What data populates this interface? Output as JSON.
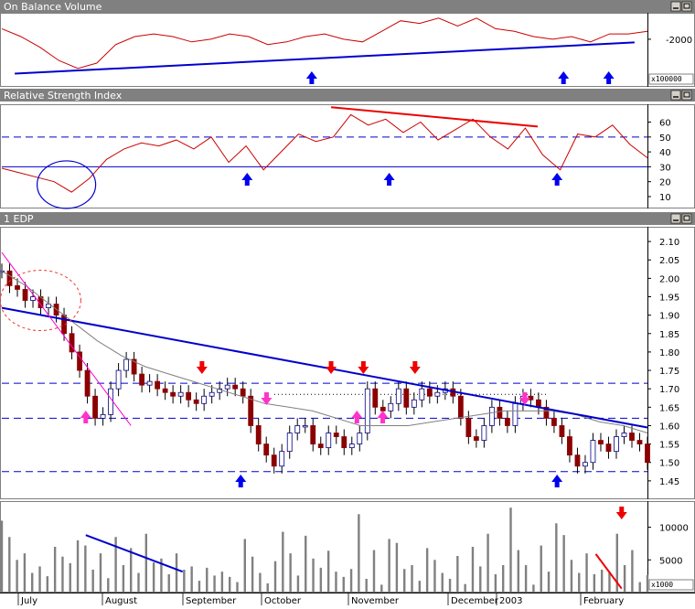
{
  "theme": {
    "titlebar": "#808080",
    "price_line": "#cc0000",
    "trend": "#0000cc",
    "ma": "#808080",
    "volume": "#808080",
    "arrow_blue": "#0000ee",
    "arrow_red": "#ee0000",
    "arrow_magenta": "#ff33cc",
    "divergence": "#ee0000"
  },
  "window_controls": [
    "minimize-icon",
    "maximize-icon"
  ],
  "months": [
    "July",
    "August",
    "September",
    "October",
    "November",
    "December",
    "2003",
    "February"
  ],
  "chart_data": [
    {
      "id": "obv",
      "type": "line",
      "title": "On Balance Volume",
      "scale_label": "x100000",
      "y_ticks": [
        -2000
      ],
      "ylim": [
        -2900,
        -1500
      ],
      "series": [
        {
          "values": [
            -1800,
            -1950,
            -2150,
            -2400,
            -2550,
            -2450,
            -2100,
            -1950,
            -1900,
            -1950,
            -2050,
            -2000,
            -1900,
            -1950,
            -2100,
            -2050,
            -1950,
            -1900,
            -2000,
            -2050,
            -1850,
            -1650,
            -1700,
            -1600,
            -1750,
            -1600,
            -1800,
            -1850,
            -1950,
            -2000,
            -1950,
            -2050,
            -1900,
            -1900,
            -1850
          ]
        }
      ],
      "trendlines": [
        {
          "from": [
            0.02,
            -2650
          ],
          "to": [
            0.98,
            -2060
          ]
        }
      ],
      "annotations": {
        "arrows_up": [
          0.48,
          0.87,
          0.94
        ]
      }
    },
    {
      "id": "rsi",
      "type": "line",
      "title": "Relative Strength Index",
      "y_ticks": [
        10,
        20,
        30,
        40,
        50,
        60
      ],
      "ylim": [
        2,
        72
      ],
      "ref_lines": {
        "dashed": [
          50
        ],
        "solid": [
          30
        ]
      },
      "series": [
        {
          "values": [
            29,
            26,
            23,
            20,
            13,
            22,
            35,
            42,
            46,
            44,
            48,
            42,
            50,
            33,
            44,
            28,
            40,
            52,
            47,
            50,
            65,
            58,
            62,
            53,
            60,
            48,
            55,
            62,
            50,
            42,
            56,
            38,
            28,
            52,
            50,
            58,
            45,
            36
          ]
        }
      ],
      "trendlines": [
        {
          "from": [
            0.51,
            70
          ],
          "to": [
            0.83,
            57
          ]
        }
      ],
      "annotations": {
        "arrows_up": [
          0.38,
          0.6,
          0.86
        ],
        "ellipse": [
          0.1,
          18
        ]
      }
    },
    {
      "id": "price",
      "type": "candlestick",
      "title": "1 EDP",
      "y_ticks": [
        1.45,
        1.5,
        1.55,
        1.6,
        1.65,
        1.7,
        1.75,
        1.8,
        1.85,
        1.9,
        1.95,
        2.0,
        2.05,
        2.1
      ],
      "ylim": [
        1.4,
        2.14
      ],
      "ref_lines": {
        "dashed": [
          1.715,
          1.62,
          1.475
        ],
        "dotted": [
          1.685
        ]
      },
      "trendlines": [
        {
          "from": [
            0.0,
            1.92
          ],
          "to": [
            1.0,
            1.595
          ]
        },
        {
          "from": [
            0.0,
            2.07
          ],
          "to": [
            0.2,
            1.6
          ]
        }
      ],
      "closes": [
        2.02,
        1.98,
        1.97,
        1.94,
        1.95,
        1.92,
        1.93,
        1.9,
        1.85,
        1.8,
        1.75,
        1.68,
        1.62,
        1.63,
        1.7,
        1.75,
        1.78,
        1.74,
        1.71,
        1.72,
        1.7,
        1.69,
        1.68,
        1.69,
        1.67,
        1.66,
        1.68,
        1.69,
        1.7,
        1.71,
        1.7,
        1.68,
        1.6,
        1.55,
        1.52,
        1.49,
        1.53,
        1.58,
        1.6,
        1.6,
        1.55,
        1.54,
        1.58,
        1.57,
        1.54,
        1.55,
        1.58,
        1.7,
        1.65,
        1.64,
        1.66,
        1.7,
        1.65,
        1.67,
        1.7,
        1.68,
        1.69,
        1.7,
        1.68,
        1.62,
        1.57,
        1.56,
        1.6,
        1.65,
        1.62,
        1.6,
        1.66,
        1.68,
        1.67,
        1.65,
        1.62,
        1.6,
        1.57,
        1.52,
        1.49,
        1.5,
        1.56,
        1.55,
        1.53,
        1.57,
        1.58,
        1.56,
        1.55,
        1.5
      ],
      "moving_average": [
        2.02,
        1.98,
        1.93,
        1.88,
        1.83,
        1.79,
        1.76,
        1.74,
        1.72,
        1.7,
        1.68,
        1.66,
        1.65,
        1.64,
        1.62,
        1.6,
        1.6,
        1.6,
        1.61,
        1.62,
        1.63,
        1.64,
        1.64,
        1.64,
        1.63,
        1.61,
        1.6,
        1.58
      ],
      "annotations": {
        "arrows_up_blue": [
          0.37,
          0.86
        ],
        "arrows_down_red": [
          0.31,
          0.51,
          0.56,
          0.64
        ],
        "arrows_up_magenta": [
          0.13,
          0.55,
          0.59
        ],
        "arrows_down_magenta": [
          0.41,
          0.81
        ],
        "ellipse": [
          0.06,
          1.94
        ]
      }
    },
    {
      "id": "volume",
      "type": "bar",
      "scale_label": "x1000",
      "y_ticks": [
        5000,
        10000
      ],
      "ylim": [
        0,
        14000
      ],
      "values": [
        11000,
        8500,
        5000,
        6000,
        3000,
        4000,
        2500,
        7000,
        5500,
        4500,
        8000,
        7200,
        3500,
        6000,
        2200,
        8500,
        4200,
        6800,
        3000,
        9000,
        4600,
        5200,
        2800,
        6000,
        3500,
        4000,
        1800,
        3800,
        2600,
        3200,
        2400,
        1600,
        8200,
        5500,
        3000,
        1400,
        4800,
        9300,
        6000,
        2600,
        8700,
        5200,
        3800,
        6400,
        3200,
        2400,
        3600,
        12000,
        2100,
        6500,
        1200,
        8200,
        7600,
        3600,
        4200,
        1800,
        6800,
        5000,
        3000,
        2100,
        5600,
        1300,
        7000,
        4000,
        9000,
        2800,
        4200,
        13000,
        6500,
        4200,
        1200,
        7200,
        3200,
        10600,
        8800,
        5000,
        3000,
        6000,
        2800,
        3500,
        3200,
        9000,
        4200,
        6500,
        1600,
        2700
      ],
      "trendlines": [
        {
          "from": [
            0.13,
            8800
          ],
          "to": [
            0.28,
            3200
          ]
        },
        {
          "from": [
            0.92,
            5900
          ],
          "to": [
            0.96,
            600
          ]
        }
      ],
      "annotations": {
        "arrow_down_red": [
          0.96,
          11200
        ]
      }
    }
  ]
}
